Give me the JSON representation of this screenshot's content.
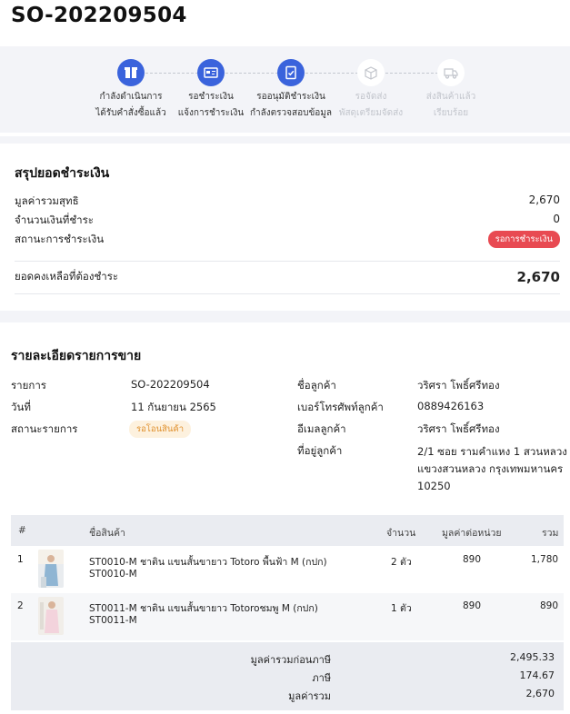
{
  "order": {
    "number": "SO-202209504"
  },
  "steps": [
    {
      "line1": "กำลังดำเนินการ",
      "line2": "ได้รับคำสั่งซื้อแล้ว",
      "icon": "box-icon",
      "state": "active"
    },
    {
      "line1": "รอชำระเงิน",
      "line2": "แจ้งการชำระเงิน",
      "icon": "payment-card-icon",
      "state": "active"
    },
    {
      "line1": "รออนุมัติชำระเงิน",
      "line2": "กำลังตรวจสอบข้อมูล",
      "icon": "document-check-icon",
      "state": "active"
    },
    {
      "line1": "รอจัดส่ง",
      "line2": "พัสดุเตรียมจัดส่ง",
      "icon": "package-icon",
      "state": "inactive"
    },
    {
      "line1": "ส่งสินค้าแล้ว",
      "line2": "เรียบร้อย",
      "icon": "truck-icon",
      "state": "inactive"
    }
  ],
  "payment_summary": {
    "title": "สรุปยอดชำระเงิน",
    "net_total_label": "มูลค่ารวมสุทธิ",
    "net_total_value": "2,670",
    "paid_label": "จำนวนเงินที่ชำระ",
    "paid_value": "0",
    "status_label": "สถานะการชำระเงิน",
    "status_value": "รอการชำระเงิน",
    "balance_label": "ยอดคงเหลือที่ต้องชำระ",
    "balance_value": "2,670"
  },
  "sales_detail": {
    "title": "รายละเอียดรายการขาย",
    "item_label": "รายการ",
    "item_value": "SO-202209504",
    "date_label": "วันที่",
    "date_value": "11 กันยายน 2565",
    "status_label": "สถานะรายการ",
    "status_value": "รอโอนสินค้า",
    "customer_name_label": "ชื่อลูกค้า",
    "customer_name_value": "วริศรา โพธิ์ศรีทอง",
    "phone_label": "เบอร์โทรศัพท์ลูกค้า",
    "phone_value": "0889426163",
    "email_label": "อีเมลลูกค้า",
    "email_value": "วริศรา โพธิ์ศรีทอง",
    "address_label": "ที่อยู่ลูกค้า",
    "address_value": "2/1 ซอย รามคำแหง 1 สวนหลวง แขวงสวนหลวง กรุงเทพมหานคร 10250"
  },
  "table": {
    "headers": {
      "index": "#",
      "product": "ชื่อสินค้า",
      "qty": "จำนวน",
      "unit_price": "มูลค่าต่อหน่วย",
      "total": "รวม"
    },
    "rows": [
      {
        "index": "1",
        "name": "ST0010-M ชาติน แขนสั้นขายาว Totoro พื้นฟ้า M (กปก)",
        "sku": "ST0010-M",
        "qty": "2 ตัว",
        "unit_price": "890",
        "total": "1,780"
      },
      {
        "index": "2",
        "name": "ST0011-M ชาติน แขนสั้นขายาว Totoroชมพู M (กปก)",
        "sku": "ST0011-M",
        "qty": "1 ตัว",
        "unit_price": "890",
        "total": "890"
      }
    ]
  },
  "totals": {
    "subtotal_label": "มูลค่ารวมก่อนภาษี",
    "subtotal_value": "2,495.33",
    "tax_label": "ภาษี",
    "tax_value": "174.67",
    "grand_label": "มูลค่ารวม",
    "grand_value": "2,670"
  },
  "colors": {
    "accent": "#3a63dc",
    "danger": "#e84a52",
    "warning_bg": "#fdf1de",
    "warning_text": "#e0912f"
  }
}
